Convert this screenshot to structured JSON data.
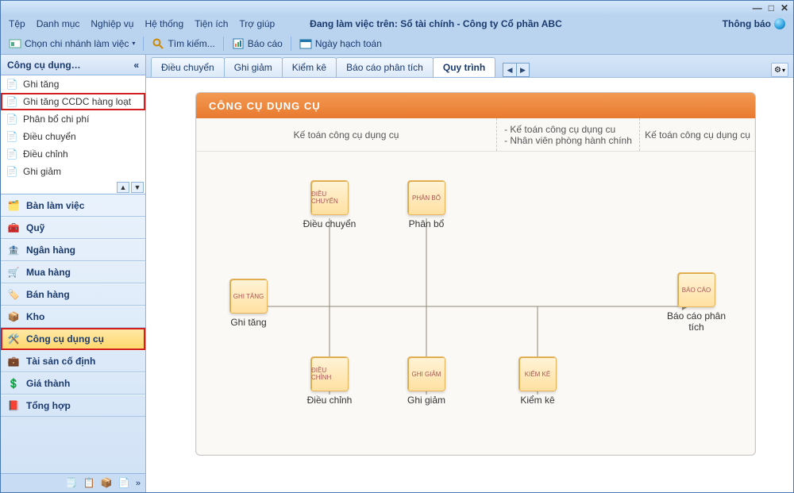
{
  "titlebar": {
    "minimize": "—",
    "maximize": "□",
    "close": "✕"
  },
  "menubar": {
    "items": [
      "Tệp",
      "Danh mục",
      "Nghiệp vụ",
      "Hệ thống",
      "Tiện ích",
      "Trợ giúp"
    ],
    "work_prefix": "Đang làm việc trên:",
    "work_value": "Sổ tài chính - Công ty Cổ phần ABC",
    "notify": "Thông báo"
  },
  "toolbar2": {
    "choose_branch": "Chọn chi nhánh làm việc",
    "search": "Tìm kiếm...",
    "report": "Báo cáo",
    "accounting_date": "Ngày hạch toán"
  },
  "sidebar": {
    "header": "Công cụ dụng…",
    "collapse": "«",
    "items": [
      {
        "label": "Ghi tăng"
      },
      {
        "label": "Ghi tăng CCDC hàng loạt",
        "highlight": true
      },
      {
        "label": "Phân bổ chi phí"
      },
      {
        "label": "Điều chuyển"
      },
      {
        "label": "Điều chỉnh"
      },
      {
        "label": "Ghi giảm"
      }
    ],
    "nav": [
      {
        "label": "Bàn làm việc"
      },
      {
        "label": "Quỹ"
      },
      {
        "label": "Ngân hàng"
      },
      {
        "label": "Mua hàng"
      },
      {
        "label": "Bán hàng"
      },
      {
        "label": "Kho"
      },
      {
        "label": "Công cụ dụng cụ",
        "selected": true
      },
      {
        "label": "Tài sản cố định"
      },
      {
        "label": "Giá thành"
      },
      {
        "label": "Tổng hợp"
      }
    ],
    "footer_chevron": "»"
  },
  "tabs": {
    "items": [
      "Điều chuyển",
      "Ghi giảm",
      "Kiểm kê",
      "Báo cáo phân tích",
      "Quy trình"
    ],
    "active_index": 4
  },
  "panel": {
    "title": "CÔNG CỤ DỤNG CỤ",
    "columns": {
      "c1": "Kế toán công cụ dụng cụ",
      "c2a": "- Kế toán công cụ dụng cu",
      "c2b": "- Nhân viên phòng hành chính",
      "c3": "Kế toán công cụ dụng cụ"
    },
    "nodes": {
      "ghi_tang": "Ghi tăng",
      "dieu_chuyen": "Điều chuyển",
      "phan_bo": "Phân bổ",
      "dieu_chinh": "Điều chỉnh",
      "ghi_giam": "Ghi giảm",
      "kiem_ke": "Kiểm kê",
      "bao_cao": "Báo cáo phân tích"
    },
    "chips": {
      "ghi_tang": "GHI TĂNG",
      "dieu_chuyen": "ĐIỀU CHUYỂN",
      "phan_bo": "PHÂN BỔ",
      "dieu_chinh": "ĐIỀU CHỈNH",
      "ghi_giam": "GHI GIẢM",
      "kiem_ke": "KIỂM KÊ",
      "bao_cao": "BÁO CÁO"
    }
  }
}
